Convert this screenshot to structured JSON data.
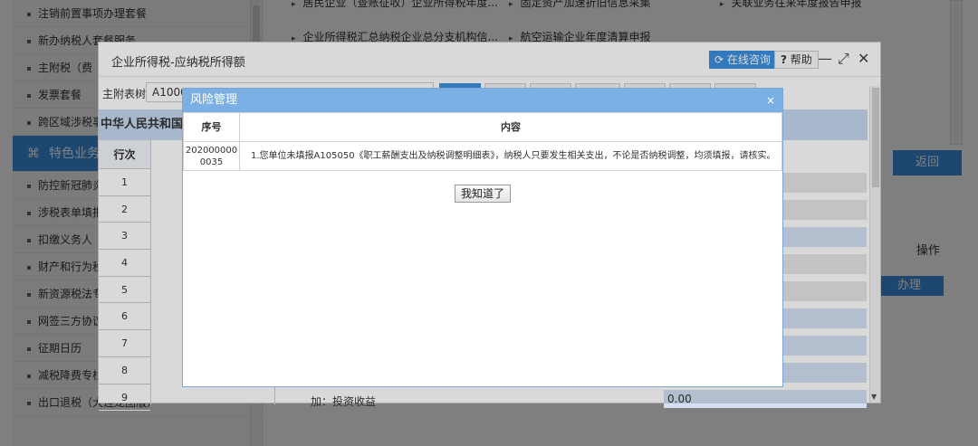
{
  "sidebar": {
    "items": [
      {
        "label": "注销前置事项办理套餐"
      },
      {
        "label": "新办纳税人套餐服务"
      },
      {
        "label": "主附税（费"
      },
      {
        "label": "发票套餐"
      },
      {
        "label": "跨区域涉税事"
      },
      {
        "label": "特色业务",
        "active": true
      },
      {
        "label": "防控新冠肺炎"
      },
      {
        "label": "涉税表单填报"
      },
      {
        "label": "扣缴义务人"
      },
      {
        "label": "财产和行为税"
      },
      {
        "label": "新资源税法专"
      },
      {
        "label": "网签三方协议"
      },
      {
        "label": "征期日历"
      },
      {
        "label": "减税降费专栏"
      },
      {
        "label": "出口退税（大连龙图版）"
      }
    ]
  },
  "background": {
    "links": [
      "居民企业（查账征收）企业所得税年度...",
      "固定资产加速折旧信息采集",
      "关联业务往来年度报告申报",
      "企业所得税汇总纳税企业总分支机构信...",
      "航空运输企业年度清算申报"
    ],
    "return_label": "返回",
    "operation_label": "操作",
    "handle_label": "办理"
  },
  "dialog": {
    "title": "企业所得税-应纳税所得额",
    "consult_label": "在线咨询",
    "help_label": "帮助",
    "minimize": "—",
    "maximize": "⤢",
    "close": "✕",
    "attach_label": "主附表树:",
    "attach_value": "A10000",
    "form_header": "中华人民共和国企",
    "row_col_header": "行次",
    "rows": [
      "1",
      "2",
      "3",
      "4",
      "5",
      "6",
      "7",
      "8",
      "9"
    ],
    "last_row_label": "加：投资收益",
    "last_row_value": "0.00"
  },
  "risk_modal": {
    "title": "风险管理",
    "close": "×",
    "col_seq": "序号",
    "col_content": "内容",
    "row": {
      "seq": "2020000000035",
      "content": "1.您单位未填报A105050《职工薪酬支出及纳税调整明细表》，纳税人只要发生相关支出，不论是否纳税调整，均须填报，请核实。"
    },
    "ok_label": "我知道了"
  },
  "colors": {
    "accent": "#3d8fe0",
    "risk_header": "#7bb0e5",
    "form_header_bg": "#c6d8ef"
  }
}
